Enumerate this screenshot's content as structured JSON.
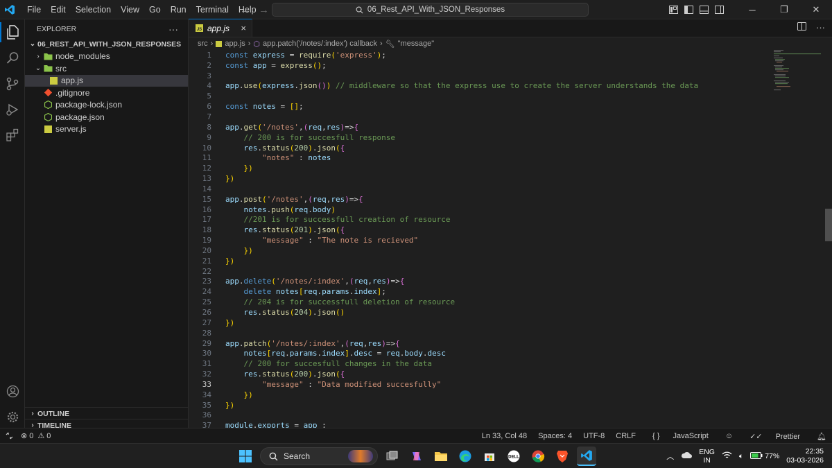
{
  "menu": [
    "File",
    "Edit",
    "Selection",
    "View",
    "Go",
    "Run",
    "Terminal",
    "Help"
  ],
  "command_center": "06_Rest_API_With_JSON_Responses",
  "explorer": {
    "title": "EXPLORER",
    "more": "···",
    "root": "06_REST_API_WITH_JSON_RESPONSES",
    "items": [
      {
        "label": "node_modules",
        "icon": "folder-icon",
        "depth": 1,
        "chevron": "›"
      },
      {
        "label": "src",
        "icon": "folder-icon",
        "depth": 1,
        "chevron": "⌄"
      },
      {
        "label": "app.js",
        "icon": "js-file-icon",
        "depth": 2,
        "chevron": ""
      },
      {
        "label": ".gitignore",
        "icon": "git-icon",
        "depth": 1,
        "chevron": ""
      },
      {
        "label": "package-lock.json",
        "icon": "node-icon",
        "depth": 1,
        "chevron": ""
      },
      {
        "label": "package.json",
        "icon": "node-icon",
        "depth": 1,
        "chevron": ""
      },
      {
        "label": "server.js",
        "icon": "js-file-icon",
        "depth": 1,
        "chevron": ""
      }
    ],
    "outline": "OUTLINE",
    "timeline": "TIMELINE"
  },
  "tab": {
    "label": "app.js",
    "close": "×"
  },
  "breadcrumb": {
    "src": "src",
    "file": "app.js",
    "callback": "app.patch('/notes/:index') callback",
    "symbol": "\"message\""
  },
  "code": {
    "current_line": 33,
    "lines": [
      "const express = require('express');",
      "const app = express();",
      "",
      "app.use(express.json()) // middleware so that the express use to create the server understands the data",
      "",
      "const notes = [];",
      "",
      "app.get('/notes',(req,res)=>{",
      "    // 200 is for succesfull response",
      "    res.status(200).json({",
      "        \"notes\" : notes",
      "    })",
      "})",
      "",
      "app.post('/notes',(req,res)=>{",
      "    notes.push(req.body)",
      "    //201 is for successfull creation of resource",
      "    res.status(201).json({",
      "        \"message\" : \"The note is recieved\"",
      "    })",
      "})",
      "",
      "app.delete('/notes/:index',(req,res)=>{",
      "    delete notes[req.params.index];",
      "    // 204 is for successfull deletion of resource",
      "    res.status(204).json()",
      "})",
      "",
      "app.patch('/notes/:index',(req,res)=>{",
      "    notes[req.params.index].desc = req.body.desc",
      "    // 200 for succesfull changes in the data",
      "    res.status(200).json({",
      "        \"message\" : \"Data modified succesfully\"",
      "    })",
      "})",
      "",
      "module.exports = app ;"
    ]
  },
  "status": {
    "errors": "0",
    "warnings": "0",
    "position": "Ln 33, Col 48",
    "spaces": "Spaces: 4",
    "encoding": "UTF-8",
    "eol": "CRLF",
    "language": "JavaScript",
    "prettier": "Prettier"
  },
  "taskbar": {
    "search": "Search",
    "lang_top": "ENG",
    "lang_bottom": "IN",
    "battery": "77%",
    "time": "22:35",
    "date": "03-03-2026"
  },
  "colors": {
    "accent": "#0078d4",
    "keyword": "#569cd6",
    "string": "#ce9178",
    "comment": "#6a9955"
  }
}
